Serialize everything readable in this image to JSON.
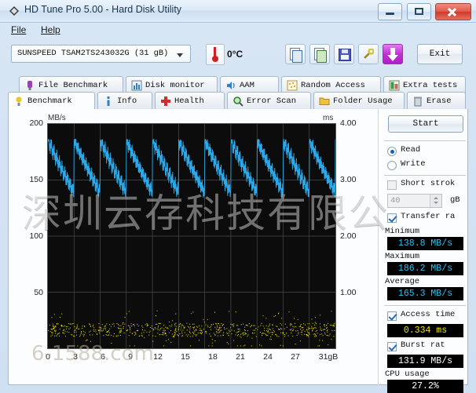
{
  "window": {
    "title": "HD Tune Pro 5.00 - Hard Disk Utility",
    "icon": "hdtune-diamond-icon",
    "minimize_label": "",
    "maximize_label": "",
    "close_label": ""
  },
  "menu": {
    "items": [
      {
        "label": "File",
        "mnemonic": "F"
      },
      {
        "label": "Help",
        "mnemonic": "H"
      }
    ]
  },
  "toolbar": {
    "drive": "SUNSPEED TSAM2TS243032G (31 gB)",
    "temperature": "0",
    "temperature_unit": "°C",
    "buttons": [
      {
        "name": "copy-button",
        "icon": "copy-icon"
      },
      {
        "name": "copy-excel-button",
        "icon": "copy-sheet-icon"
      },
      {
        "name": "save-button",
        "icon": "floppy-icon"
      },
      {
        "name": "options-button",
        "icon": "wrench-icon"
      },
      {
        "name": "download-button",
        "icon": "down-arrow-icon"
      }
    ],
    "exit_label": "Exit"
  },
  "tabs_row1": [
    {
      "label": "File Benchmark",
      "icon": "file-benchmark-icon",
      "active": false
    },
    {
      "label": "Disk monitor",
      "icon": "disk-monitor-icon",
      "active": false
    },
    {
      "label": "AAM",
      "icon": "aam-speaker-icon",
      "active": false
    },
    {
      "label": "Random Access",
      "icon": "random-access-icon",
      "active": false
    },
    {
      "label": "Extra tests",
      "icon": "extra-tests-icon",
      "active": false
    }
  ],
  "tabs_row2": [
    {
      "label": "Benchmark",
      "icon": "benchmark-bulb-icon",
      "active": true
    },
    {
      "label": "Info",
      "icon": "info-icon",
      "active": false
    },
    {
      "label": "Health",
      "icon": "health-cross-icon",
      "active": false
    },
    {
      "label": "Error Scan",
      "icon": "error-scan-magnifier-icon",
      "active": false
    },
    {
      "label": "Folder Usage",
      "icon": "folder-usage-icon",
      "active": false
    },
    {
      "label": "Erase",
      "icon": "erase-trash-icon",
      "active": false
    }
  ],
  "controls": {
    "start_label": "Start",
    "read_label": "Read",
    "write_label": "Write",
    "read_selected": true,
    "short_stroke_label": "Short strok",
    "short_stroke_checked": false,
    "short_stroke_value": "40",
    "short_stroke_unit": "gB",
    "transfer_rate_label": "Transfer ra",
    "transfer_rate_checked": true,
    "access_time_label": "Access time",
    "access_time_checked": true,
    "burst_rate_label": "Burst rat",
    "burst_rate_checked": true
  },
  "results": {
    "minimum_label": "Minimum",
    "minimum_value": "138.8 MB/s",
    "maximum_label": "Maximum",
    "maximum_value": "186.2 MB/s",
    "average_label": "Average",
    "average_value": "165.3 MB/s",
    "access_time_value": "0.334 ms",
    "burst_rate_value": "131.9 MB/s",
    "cpu_usage_label": "CPU usage",
    "cpu_usage_value": "27.2%"
  },
  "watermark": {
    "line1": "深圳云存科技有限公",
    "line2": "6-1588.com"
  },
  "chart_data": {
    "type": "line",
    "title": "",
    "ylabel": "MB/s",
    "ylabel_right": "ms",
    "xlabel": "gB",
    "ylim": [
      0,
      200
    ],
    "ylim_right": [
      0,
      4.0
    ],
    "xlim": [
      0,
      31
    ],
    "yticks": [
      200,
      150,
      100,
      50
    ],
    "yticks_right": [
      "4.00",
      "3.00",
      "2.00",
      "1.00"
    ],
    "xticks": [
      "0",
      "3",
      "6",
      "9",
      "12",
      "15",
      "18",
      "21",
      "24",
      "27",
      "31gB"
    ],
    "grid": true,
    "series": [
      {
        "name": "Transfer rate",
        "color": "#2ca8e8",
        "unit": "MB/s",
        "axis": "left",
        "pattern": "sawtooth",
        "peak": 186.2,
        "trough": 138.8,
        "average": 165.3,
        "cycles": 11,
        "values": [
          183,
          178,
          172,
          168,
          163,
          158,
          154,
          150,
          186,
          180,
          175,
          170,
          165,
          160,
          156,
          152,
          148,
          185,
          179,
          174,
          169,
          164,
          159,
          155,
          151,
          184,
          178,
          173,
          168,
          163,
          158,
          153,
          149,
          186,
          181,
          176,
          171,
          166,
          161,
          157,
          152,
          148,
          185,
          180,
          174,
          169,
          164,
          160,
          155,
          151,
          183,
          178,
          172,
          167,
          162,
          158,
          153,
          149,
          186,
          180,
          175,
          170,
          165,
          160,
          156,
          151,
          147,
          184,
          179,
          173,
          168,
          163,
          159,
          154,
          150,
          185,
          180,
          175,
          170,
          165,
          160,
          155,
          150,
          146,
          183,
          178,
          173,
          168,
          163,
          158,
          154,
          150,
          185,
          180,
          175,
          170,
          166,
          161,
          157,
          153
        ]
      },
      {
        "name": "Access time",
        "color": "#e8e000",
        "unit": "ms",
        "axis": "right",
        "pattern": "scatter",
        "mean": 0.334,
        "min": 0.12,
        "max": 0.55
      }
    ]
  }
}
